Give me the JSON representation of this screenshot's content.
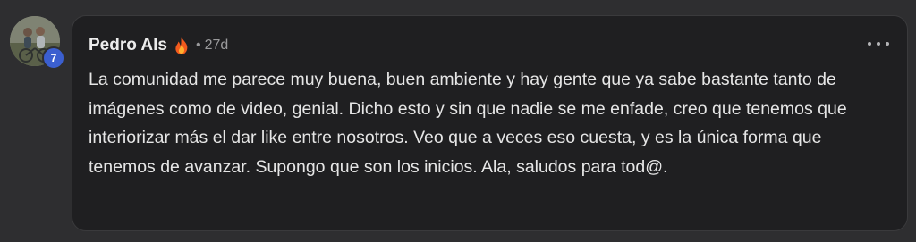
{
  "comment": {
    "avatar_alt": "Pedro Als avatar",
    "level": "7",
    "author": "Pedro Als",
    "separator": "•",
    "time": "27d",
    "text": "La comunidad me parece muy buena, buen ambiente y hay gente que ya sabe bastante tanto de imágenes como de video, genial. Dicho esto y sin que nadie se me enfade, creo que tenemos que interiorizar más el dar like entre nosotros. Veo que a veces eso cuesta, y es la única forma que tenemos de avanzar. Supongo que son los inicios. Ala, saludos para tod@.",
    "badge_icon": "flame-icon",
    "menu_icon": "more-options-icon"
  },
  "colors": {
    "page_bg": "#2e2e30",
    "card_bg": "#1f1f21",
    "level_badge": "#3b5fcf",
    "text": "#e6e6e6",
    "muted": "#9a9a9c"
  }
}
